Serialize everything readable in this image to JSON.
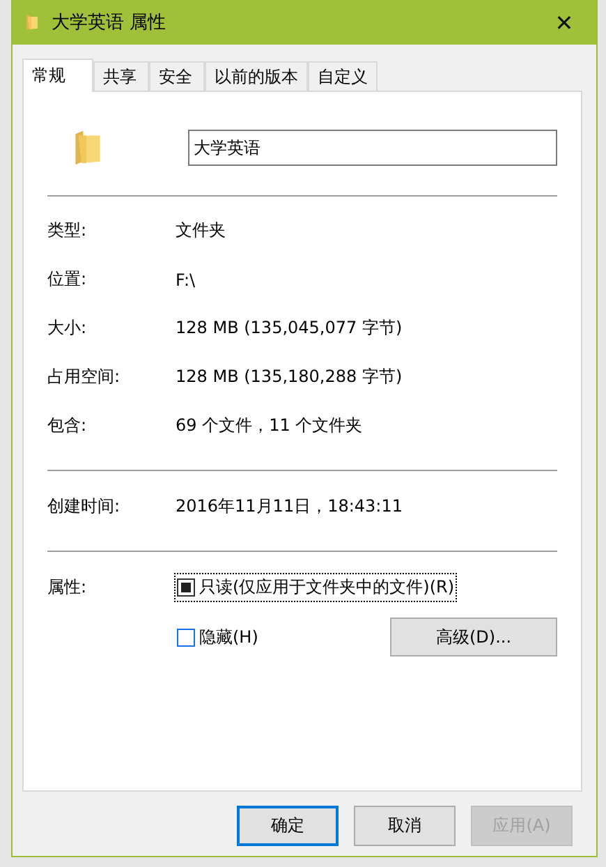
{
  "window": {
    "title": "大学英语 属性",
    "close": "✕"
  },
  "tabs": [
    {
      "label": "常规",
      "selected": true
    },
    {
      "label": "共享",
      "selected": false
    },
    {
      "label": "安全",
      "selected": false
    },
    {
      "label": "以前的版本",
      "selected": false
    },
    {
      "label": "自定义",
      "selected": false
    }
  ],
  "name_field": {
    "value": "大学英语"
  },
  "info_groups": [
    [
      {
        "label": "类型:",
        "value": "文件夹"
      },
      {
        "label": "位置:",
        "value": "F:\\"
      },
      {
        "label": "大小:",
        "value": "128 MB (135,045,077 字节)"
      },
      {
        "label": "占用空间:",
        "value": "128 MB (135,180,288 字节)"
      },
      {
        "label": "包含:",
        "value": "69 个文件，11 个文件夹"
      }
    ],
    [
      {
        "label": "创建时间:",
        "value": "2016年11月11日，18:43:11"
      }
    ]
  ],
  "attributes": {
    "label": "属性:",
    "checkboxes": [
      {
        "label": "只读(仅应用于文件夹中的文件)(R)",
        "checked": false,
        "indeterminate": true,
        "focused": true
      },
      {
        "label": "隐藏(H)",
        "checked": false,
        "indeterminate": false,
        "focused": false
      }
    ],
    "advanced_button": "高级(D)..."
  },
  "buttons": [
    {
      "label": "确定",
      "default": true,
      "disabled": false
    },
    {
      "label": "取消",
      "default": false,
      "disabled": false
    },
    {
      "label": "应用(A)",
      "default": false,
      "disabled": true
    }
  ]
}
